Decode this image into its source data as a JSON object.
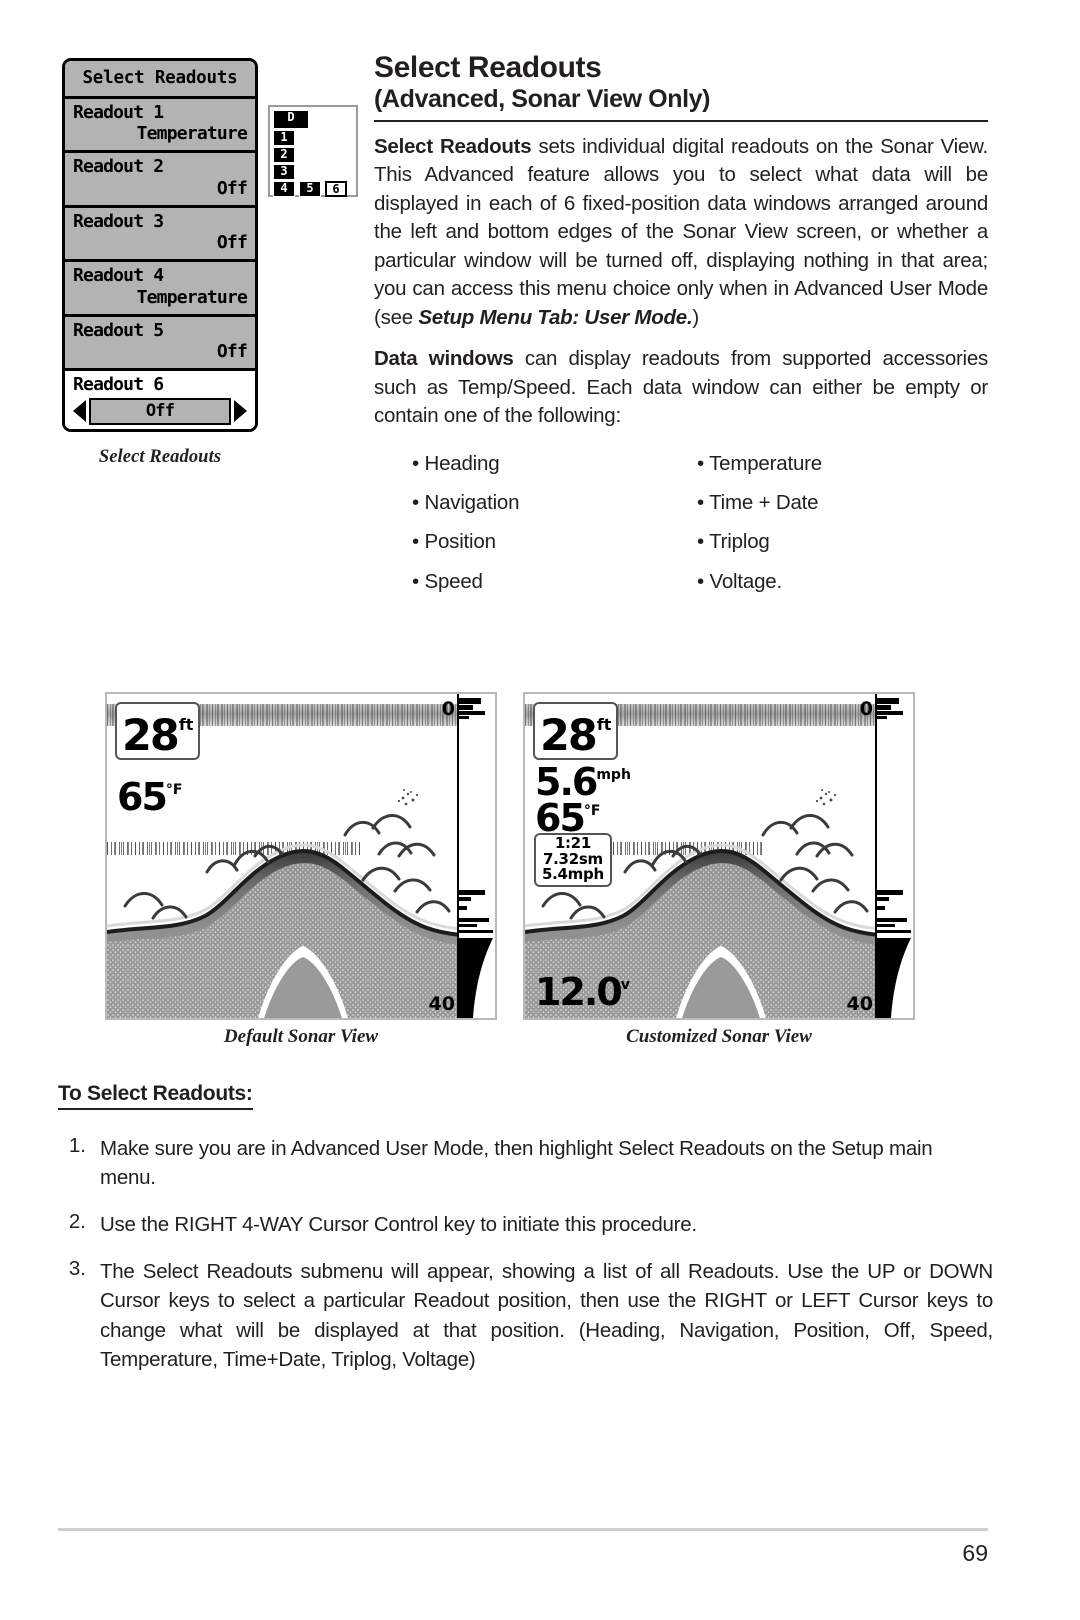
{
  "menu_figure": {
    "title": "Select Readouts",
    "caption": "Select Readouts",
    "rows": [
      {
        "label": "Readout 1",
        "value": "Temperature"
      },
      {
        "label": "Readout 2",
        "value": "Off"
      },
      {
        "label": "Readout 3",
        "value": "Off"
      },
      {
        "label": "Readout 4",
        "value": "Temperature"
      },
      {
        "label": "Readout 5",
        "value": "Off"
      }
    ],
    "selected_row": {
      "label": "Readout 6",
      "value": "Off"
    }
  },
  "layout_diagram": {
    "cells": [
      "D",
      "1",
      "2",
      "3",
      "4",
      "5",
      "6"
    ]
  },
  "article": {
    "title": "Select Readouts",
    "subtitle": "(Advanced, Sonar View Only)",
    "para1_lead": "Select Readouts",
    "para1_rest": " sets individual digital readouts on the Sonar View. This Advanced feature allows you to select what data will be displayed in each of 6 fixed-position data windows arranged around the left and bottom edges of the Sonar View screen, or whether a particular window will be turned off, displaying nothing in that area; you can access this menu choice only when in Advanced User Mode (see ",
    "para1_ref": "Setup Menu Tab: User Mode.",
    "para1_tail": ")",
    "para2_lead": "Data windows",
    "para2_rest": " can display readouts from supported accessories such as Temp/Speed. Each data window can either be empty or contain one of the following:",
    "options_left": [
      "• Heading",
      "• Navigation",
      "• Position",
      "• Speed"
    ],
    "options_right": [
      "• Temperature",
      "• Time + Date",
      "• Triplog",
      "• Voltage."
    ]
  },
  "sonar_default": {
    "caption": "Default Sonar View",
    "depth": "28",
    "depth_unit": "ft",
    "temperature": "65",
    "temperature_unit": "°F",
    "scale_top": "0",
    "scale_bottom": "40"
  },
  "sonar_custom": {
    "caption": "Customized Sonar View",
    "depth": "28",
    "depth_unit": "ft",
    "speed": "5.6",
    "speed_unit": "mph",
    "temperature": "65",
    "temperature_unit": "°F",
    "triplog_time": "1:21",
    "triplog_distance": "7.32sm",
    "triplog_speed": "5.4mph",
    "voltage": "12.0",
    "voltage_unit": "v",
    "scale_top": "0",
    "scale_bottom": "40"
  },
  "procedure": {
    "heading": "To Select Readouts:",
    "steps": [
      {
        "num": "1.",
        "text": "Make sure you are in Advanced User Mode, then highlight Select Readouts on the Setup main menu."
      },
      {
        "num": "2.",
        "text": "Use the RIGHT 4-WAY Cursor Control key to initiate this procedure."
      },
      {
        "num": "3.",
        "text": "The Select Readouts submenu will appear, showing a list of all Readouts. Use the UP or DOWN Cursor keys to select a particular Readout position, then use the RIGHT or LEFT Cursor keys to change what will be displayed at that position. (Heading, Navigation, Position, Off, Speed, Temperature, Time+Date, Triplog, Voltage)"
      }
    ]
  },
  "footer": {
    "page_number": "69"
  }
}
